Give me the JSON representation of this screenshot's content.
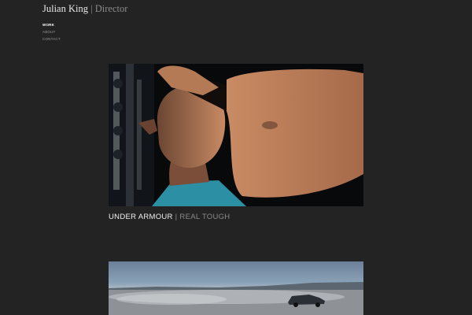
{
  "site": {
    "name": "Julian King",
    "separator": "|",
    "role": "Director"
  },
  "nav": {
    "items": [
      {
        "label": "WORK",
        "active": true
      },
      {
        "label": "ABOUT",
        "active": false
      },
      {
        "label": "CONTACT",
        "active": false
      }
    ]
  },
  "projects": [
    {
      "client": "UNDER ARMOUR",
      "separator": "|",
      "title": "REAL TOUGH",
      "image": "athlete-portrait"
    },
    {
      "client": "",
      "separator": "",
      "title": "",
      "image": "desert-car"
    }
  ],
  "colors": {
    "background": "#232323",
    "text_primary": "#f0f0f0",
    "text_muted": "#8a8a8a"
  }
}
